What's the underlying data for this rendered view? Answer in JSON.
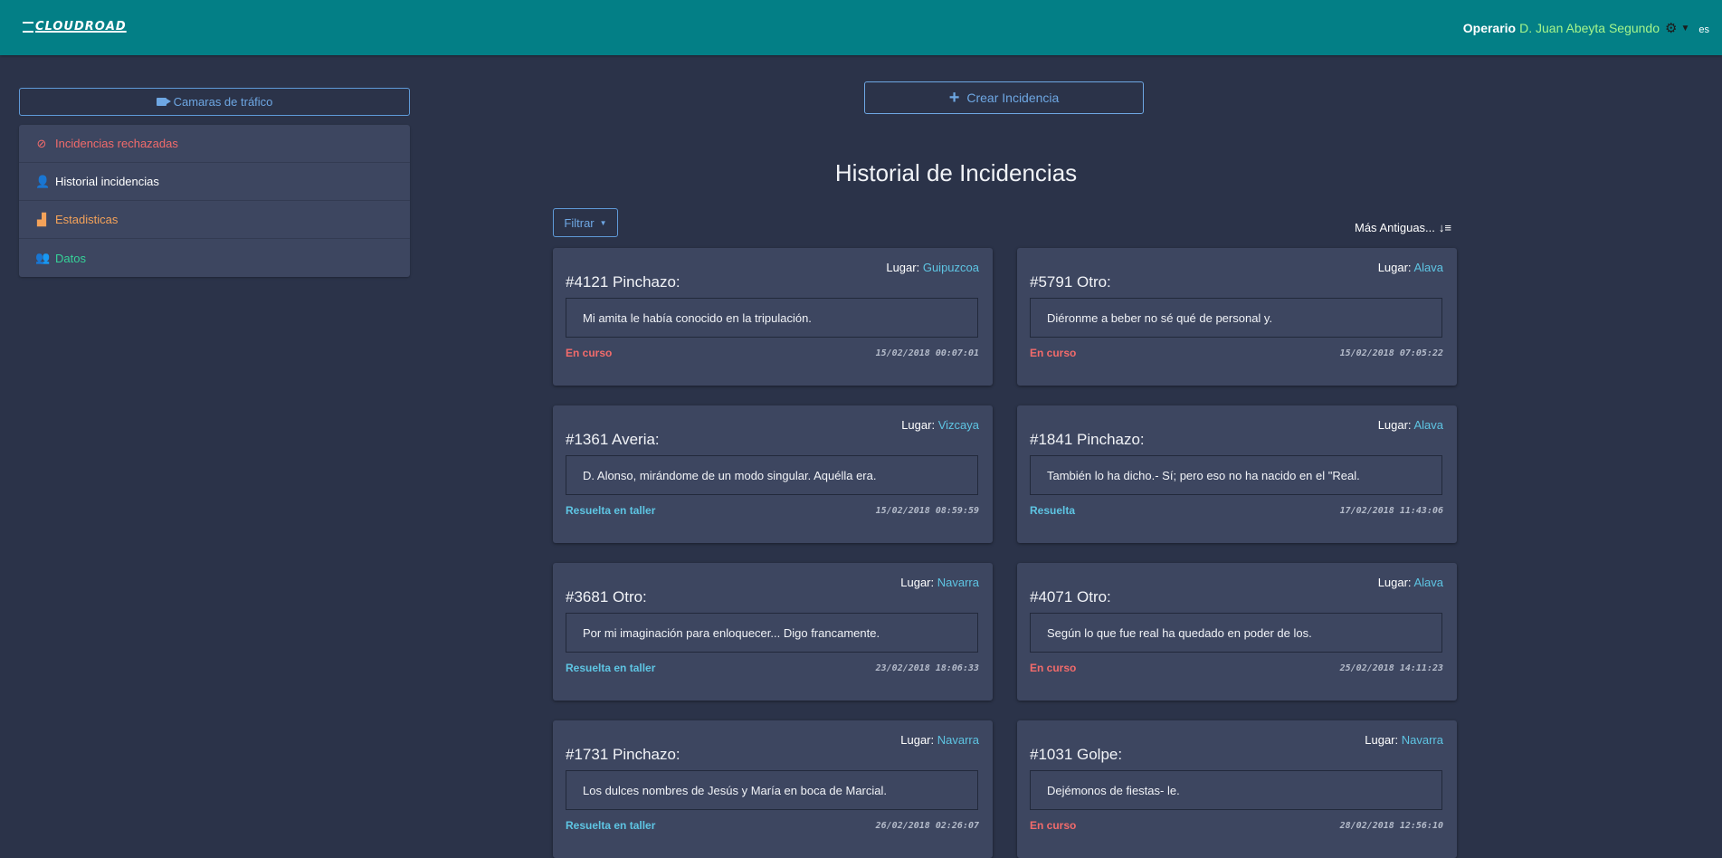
{
  "header": {
    "logo": "CLOUDROAD",
    "user_role": "Operario",
    "user_name": "D. Juan Abeyta Segundo",
    "language": "es"
  },
  "sidebar": {
    "camera_button": "Camaras de tráfico",
    "items": [
      {
        "label": "Incidencias rechazadas",
        "icon": "ban-icon",
        "color": "#f26b6b"
      },
      {
        "label": "Historial incidencias",
        "icon": "user-icon",
        "color": "#ffffff"
      },
      {
        "label": "Estadisticas",
        "icon": "chart-icon",
        "color": "#f4a259"
      },
      {
        "label": "Datos",
        "icon": "users-icon",
        "color": "#36d399"
      }
    ]
  },
  "main": {
    "create_button": "Crear Incidencia",
    "title": "Historial de Incidencias",
    "filter_button": "Filtrar",
    "sort_label": "Más Antiguas...",
    "lugar_label": "Lugar:",
    "cards": [
      {
        "title": "#4121 Pinchazo:",
        "place": "Guipuzcoa",
        "description": "Mi amita le había conocido en la tripulación.",
        "status": "En curso",
        "status_color": "#f26b6b",
        "date": "15/02/2018 00:07:01"
      },
      {
        "title": "#5791 Otro:",
        "place": "Alava",
        "description": "Diéronme a beber no sé qué de personal y.",
        "status": "En curso",
        "status_color": "#f26b6b",
        "date": "15/02/2018 07:05:22"
      },
      {
        "title": "#1361 Averia:",
        "place": "Vizcaya",
        "description": "D. Alonso, mirándome de un modo singular. Aquélla era.",
        "status": "Resuelta en taller",
        "status_color": "#5ec5e3",
        "date": "15/02/2018 08:59:59"
      },
      {
        "title": "#1841 Pinchazo:",
        "place": "Alava",
        "description": "También lo ha dicho.- Sí; pero eso no ha nacido en el \"Real.",
        "status": "Resuelta",
        "status_color": "#5ec5e3",
        "date": "17/02/2018 11:43:06"
      },
      {
        "title": "#3681 Otro:",
        "place": "Navarra",
        "description": "Por mi imaginación para enloquecer... Digo francamente.",
        "status": "Resuelta en taller",
        "status_color": "#5ec5e3",
        "date": "23/02/2018 18:06:33"
      },
      {
        "title": "#4071 Otro:",
        "place": "Alava",
        "description": "Según lo que fue real ha quedado en poder de los.",
        "status": "En curso",
        "status_color": "#f26b6b",
        "date": "25/02/2018 14:11:23"
      },
      {
        "title": "#1731 Pinchazo:",
        "place": "Navarra",
        "description": "Los dulces nombres de Jesús y María en boca de Marcial.",
        "status": "Resuelta en taller",
        "status_color": "#5ec5e3",
        "date": "26/02/2018 02:26:07"
      },
      {
        "title": "#1031 Golpe:",
        "place": "Navarra",
        "description": "Dejémonos de fiestas- le.",
        "status": "En curso",
        "status_color": "#f26b6b",
        "date": "28/02/2018 12:56:10"
      }
    ]
  }
}
